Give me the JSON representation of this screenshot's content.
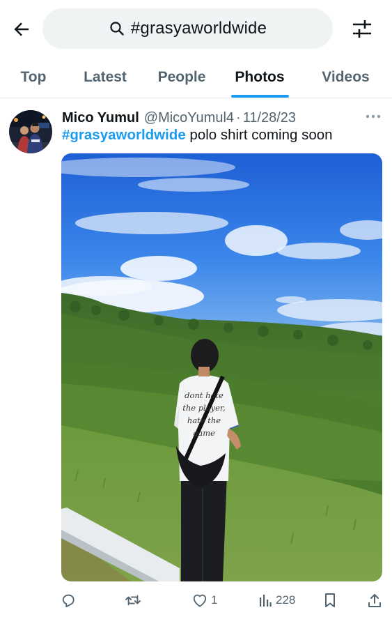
{
  "header": {
    "back_icon": "arrow-left-icon",
    "search": {
      "icon": "search-icon",
      "query": "#grasyaworldwide"
    },
    "filter_icon": "sliders-icon"
  },
  "tabs": [
    {
      "label": "Top",
      "active": false
    },
    {
      "label": "Latest",
      "active": false
    },
    {
      "label": "People",
      "active": false
    },
    {
      "label": "Photos",
      "active": true
    },
    {
      "label": "Videos",
      "active": false
    }
  ],
  "tweet": {
    "author_name": "Mico Yumul",
    "author_handle": "@MicoYumul4",
    "separator": "·",
    "date": "11/28/23",
    "hashtag": "#grasyaworldwide",
    "text": " polo shirt coming soon",
    "shirt_print": [
      "dont hate",
      "the player,",
      "hate the",
      "game"
    ],
    "actions": {
      "reply": {
        "icon": "reply-icon",
        "count": ""
      },
      "retweet": {
        "icon": "retweet-icon",
        "count": ""
      },
      "like": {
        "icon": "heart-icon",
        "count": "1"
      },
      "views": {
        "icon": "analytics-icon",
        "count": "228"
      },
      "bookmark": {
        "icon": "bookmark-icon"
      },
      "share": {
        "icon": "share-icon"
      }
    }
  },
  "colors": {
    "accent": "#1d9bf0",
    "text_primary": "#0f1419",
    "text_secondary": "#536471",
    "search_bg": "#eff3f4"
  }
}
